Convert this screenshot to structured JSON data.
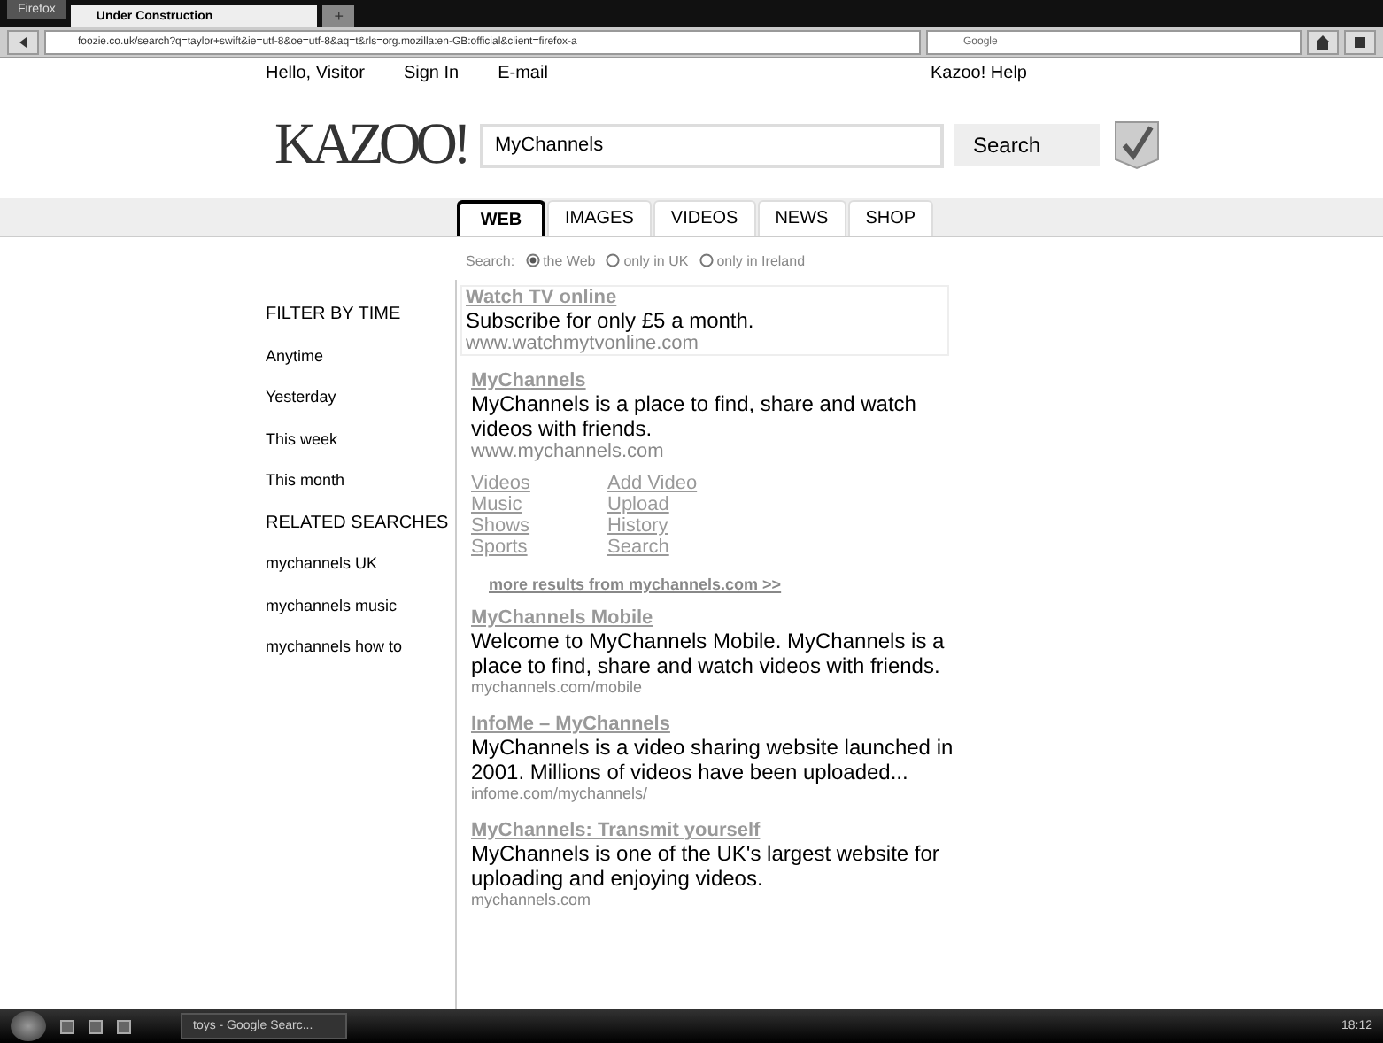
{
  "browser": {
    "menu_button": "Firefox",
    "tabs": [
      {
        "title": "Under Construction",
        "selected": true
      }
    ],
    "new_tab": "+",
    "address": "foozie.co.uk/search?q=taylor+swift&ie=utf-8&oe=utf-8&aq=t&rls=org.mozilla:en-GB:official&client=firefox-a",
    "search_engine": "Google"
  },
  "top_links": [
    "Hello, Visitor",
    "Sign In",
    "E-mail"
  ],
  "help_link": "Kazoo! Help",
  "logo": "KAZOO!",
  "search": {
    "value": "MyChannels",
    "button": "Search"
  },
  "tabs": [
    {
      "label": "WEB",
      "selected": true
    },
    {
      "label": "IMAGES",
      "selected": false
    },
    {
      "label": "VIDEOS",
      "selected": false
    },
    {
      "label": "NEWS",
      "selected": false
    },
    {
      "label": "SHOP",
      "selected": false
    }
  ],
  "scope": {
    "label": "Search:",
    "options": [
      {
        "label": "the Web",
        "selected": true
      },
      {
        "label": "only in UK",
        "selected": false
      },
      {
        "label": "only in Ireland",
        "selected": false
      }
    ]
  },
  "sidebar": [
    {
      "kind": "heading",
      "text": "FILTER BY TIME"
    },
    {
      "kind": "link",
      "text": "Anytime"
    },
    {
      "kind": "link",
      "text": "Yesterday"
    },
    {
      "kind": "link",
      "text": "This week"
    },
    {
      "kind": "link",
      "text": "This month"
    },
    {
      "kind": "heading",
      "text": "RELATED SEARCHES"
    },
    {
      "kind": "link",
      "text": "mychannels UK"
    },
    {
      "kind": "link",
      "text": "mychannels music"
    },
    {
      "kind": "link",
      "text": "mychannels how to"
    }
  ],
  "ad": {
    "title": "Watch TV online",
    "text": "Subscribe for only £5 a month.",
    "url": "www.watchmytvonline.com"
  },
  "results": [
    {
      "title": "MyChannels",
      "text": "MyChannels is a place to find, share and watch videos with friends.",
      "url": "www.mychannels.com",
      "sitelinks": [
        [
          "Videos",
          "Add Video"
        ],
        [
          "Music",
          "Upload"
        ],
        [
          "Shows",
          "History"
        ],
        [
          "Sports",
          "Search"
        ]
      ],
      "more": "more results from mychannels.com >>"
    },
    {
      "title": "MyChannels Mobile",
      "text": "Welcome to MyChannels Mobile. MyChannels is a place to find, share and watch videos with friends.",
      "url": "mychannels.com/mobile"
    },
    {
      "title": "InfoMe – MyChannels",
      "text": "MyChannels is a video sharing website launched in 2001. Millions of videos have been uploaded...",
      "url": "infome.com/mychannels/"
    },
    {
      "title": "MyChannels: Transmit yourself",
      "text": "MyChannels is one of the UK's largest website for uploading and enjoying videos.",
      "url": "mychannels.com"
    }
  ],
  "taskbar": {
    "window": "toys - Google Searc...",
    "clock": "18:12"
  }
}
